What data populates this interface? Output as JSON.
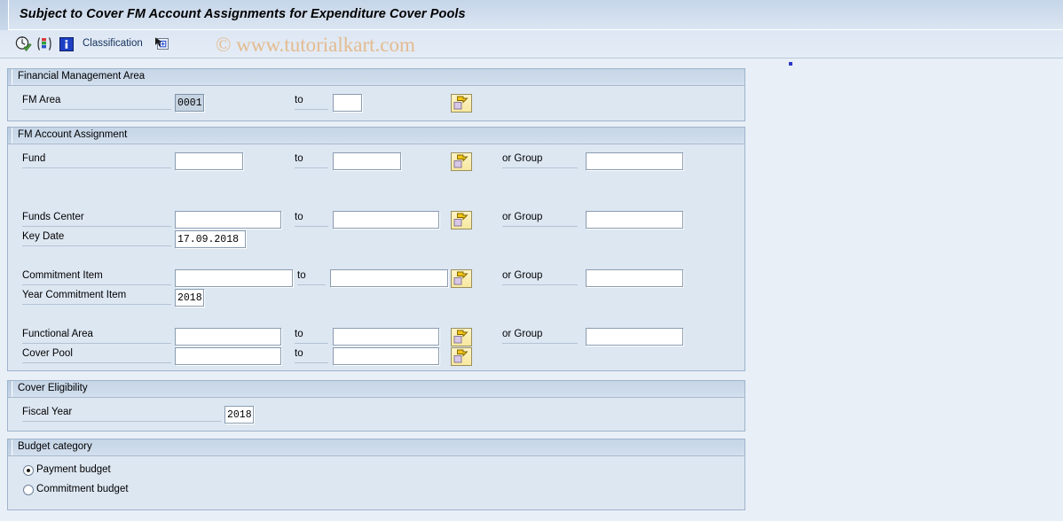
{
  "window": {
    "title": "Subject to Cover FM Account Assignments for Expenditure Cover Pools"
  },
  "watermark": "© www.tutorialkart.com",
  "toolbar": {
    "execute_icon": "execute-clock-icon",
    "variant_icon": "select-variant-icon",
    "info_icon": "info-icon",
    "classification_label": "Classification",
    "classification_icon": "dynamic-selection-icon"
  },
  "sections": [
    {
      "id": "financial-management-area",
      "title": "Financial Management Area",
      "rows": [
        {
          "id": "fm-area",
          "label": "FM Area",
          "value": "0001",
          "filled": true,
          "to_label": "to",
          "to_value": "",
          "has_multiselect": true,
          "multiselect_icon": "multiple-selection-arrow-icon"
        }
      ]
    },
    {
      "id": "fm-account-assignment",
      "title": "FM Account Assignment",
      "rows": [
        {
          "id": "fund",
          "label": "Fund",
          "value": "",
          "to_label": "to",
          "to_value": "",
          "has_multiselect": true,
          "multiselect_icon": "multiple-selection-arrow-icon",
          "or_group_label": "or Group",
          "or_group_value": ""
        },
        {
          "id": "funds-center",
          "label": "Funds Center",
          "value": "",
          "to_label": "to",
          "to_value": "",
          "has_multiselect": true,
          "multiselect_icon": "multiple-selection-arrow-icon",
          "or_group_label": "or Group",
          "or_group_value": ""
        },
        {
          "id": "key-date",
          "label": "Key Date",
          "value": "17.09.2018"
        },
        {
          "id": "commitment-item",
          "label": "Commitment Item",
          "value": "",
          "to_label": "to",
          "to_value": "",
          "has_multiselect": true,
          "multiselect_icon": "multiple-selection-arrow-icon",
          "or_group_label": "or Group",
          "or_group_value": ""
        },
        {
          "id": "year-commitment-item",
          "label": "Year Commitment Item",
          "value": "2018"
        },
        {
          "id": "functional-area",
          "label": "Functional Area",
          "value": "",
          "to_label": "to",
          "to_value": "",
          "has_multiselect": true,
          "multiselect_icon": "multiple-selection-arrow-icon",
          "or_group_label": "or Group",
          "or_group_value": ""
        },
        {
          "id": "cover-pool",
          "label": "Cover Pool",
          "value": "",
          "to_label": "to",
          "to_value": "",
          "has_multiselect": true,
          "multiselect_icon": "multiple-selection-arrow-icon"
        }
      ]
    },
    {
      "id": "cover-eligibility",
      "title": "Cover Eligibility",
      "rows": [
        {
          "id": "fiscal-year",
          "label": "Fiscal Year",
          "value": "2018"
        }
      ]
    },
    {
      "id": "budget-category",
      "title": "Budget category",
      "radios": [
        {
          "id": "payment-budget",
          "label": "Payment budget",
          "selected": true
        },
        {
          "id": "commitment-budget",
          "label": "Commitment budget",
          "selected": false
        }
      ]
    }
  ],
  "colors": {
    "title_bar": "#cfdcec",
    "panel_body": "#dde7f2",
    "panel_head": "#ccdaea",
    "page_background": "#e9eff7",
    "field_border": "#8a9cb0",
    "filled_field": "#c6d3e1",
    "button_yellow": "#f7e89f",
    "watermark": "#e5b98a"
  }
}
